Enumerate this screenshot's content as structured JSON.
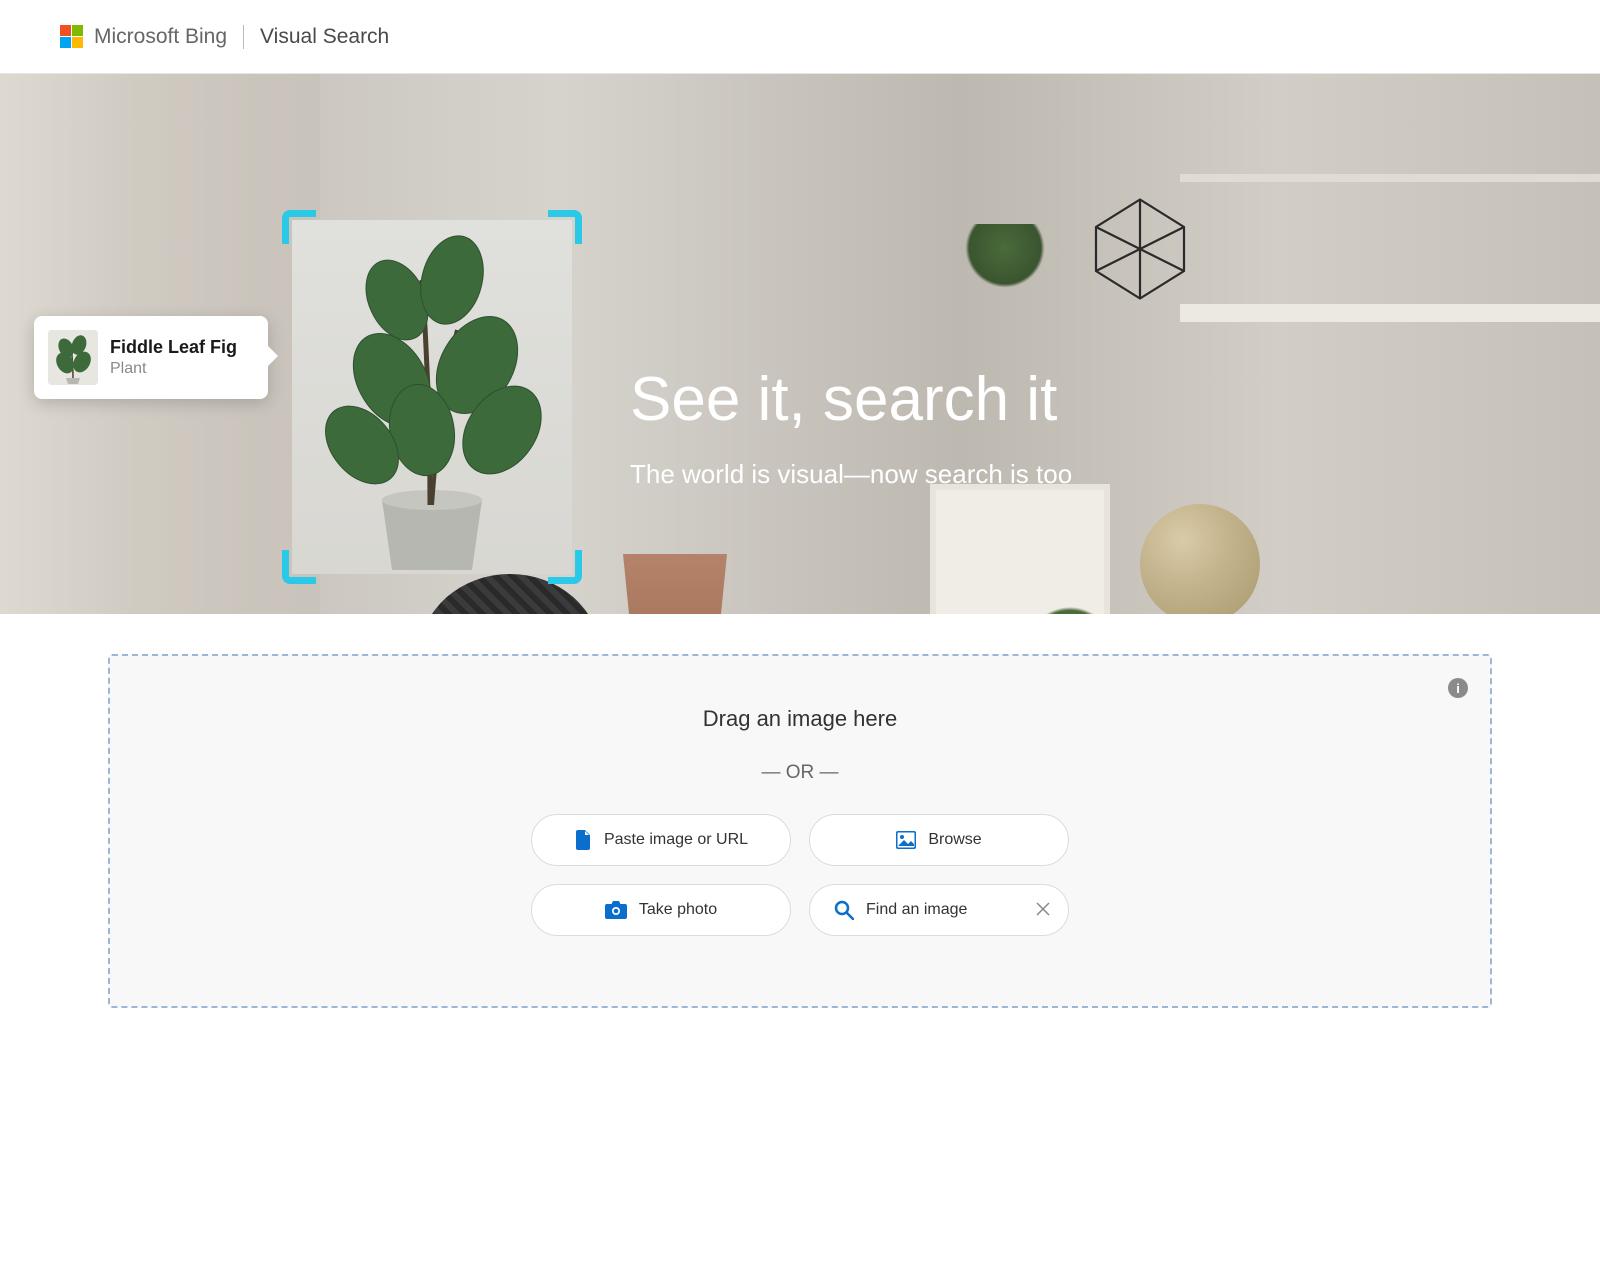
{
  "header": {
    "brand": "Microsoft Bing",
    "product": "Visual Search"
  },
  "hero": {
    "headline": "See it, search it",
    "subheadline": "The world is visual—now search is too",
    "tooltip": {
      "title": "Fiddle Leaf Fig",
      "subtitle": "Plant"
    }
  },
  "upload": {
    "drag_label": "Drag an image here",
    "or_label": "— OR —",
    "buttons": {
      "paste": "Paste image or URL",
      "browse": "Browse",
      "take_photo": "Take photo",
      "find_image": "Find an image"
    }
  },
  "colors": {
    "accent_blue": "#0b6ecc",
    "focus_cyan": "#2ac9e8"
  }
}
